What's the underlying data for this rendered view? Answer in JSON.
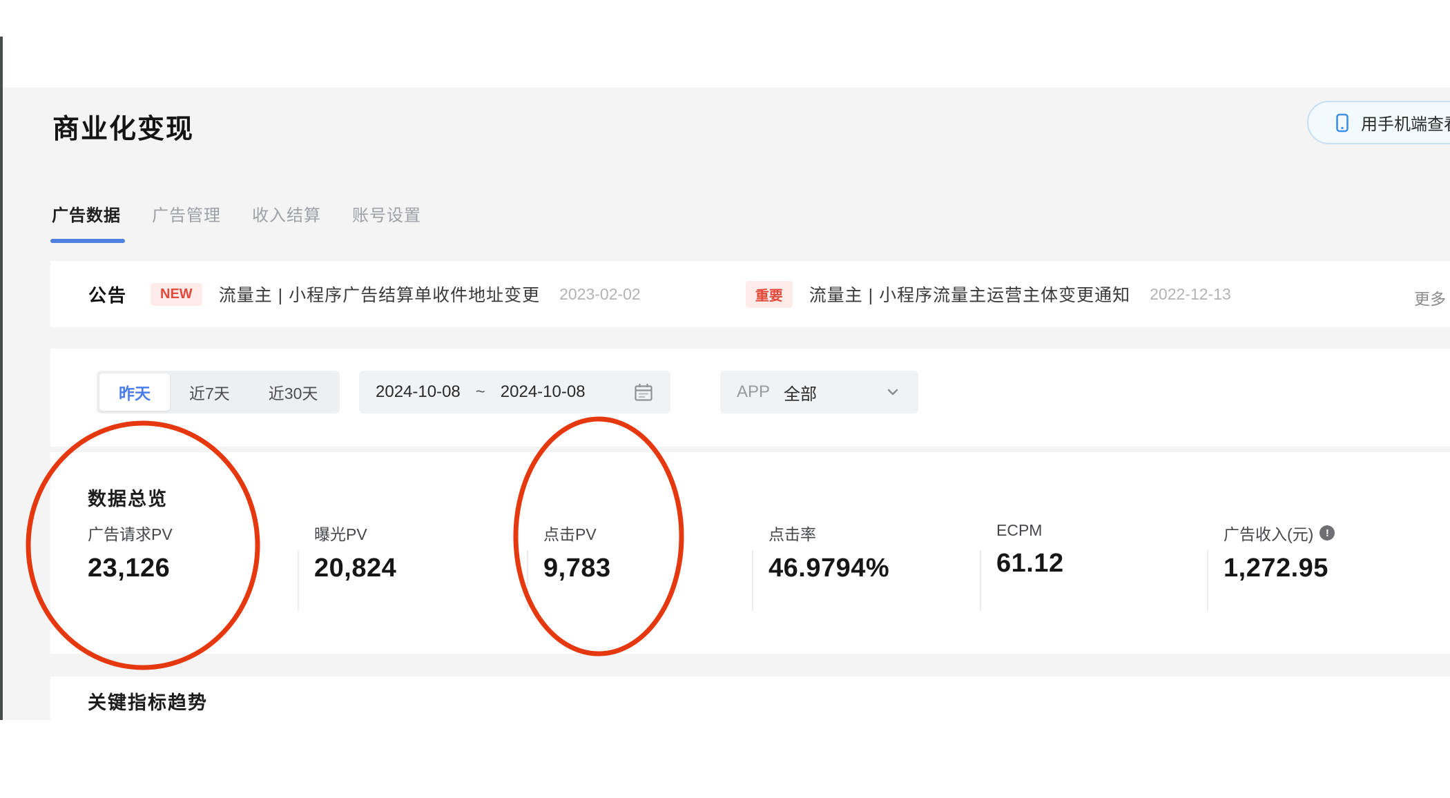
{
  "page": {
    "title": "商业化变现",
    "mobile_button_label": "用手机端查看数据",
    "more_label": "更多"
  },
  "tabs": [
    {
      "label": "广告数据",
      "active": true
    },
    {
      "label": "广告管理",
      "active": false
    },
    {
      "label": "收入结算",
      "active": false
    },
    {
      "label": "账号设置",
      "active": false
    }
  ],
  "announcement": {
    "heading": "公告",
    "items": [
      {
        "badge": "NEW",
        "text": "流量主 | 小程序广告结算单收件地址变更",
        "date": "2023-02-02"
      },
      {
        "badge": "重要",
        "text": "流量主 | 小程序流量主运营主体变更通知",
        "date": "2022-12-13"
      }
    ]
  },
  "filters": {
    "quick_ranges": [
      {
        "label": "昨天",
        "active": true
      },
      {
        "label": "近7天",
        "active": false
      },
      {
        "label": "近30天",
        "active": false
      }
    ],
    "date_start": "2024-10-08",
    "date_separator": "~",
    "date_end": "2024-10-08",
    "app_label": "APP",
    "app_value": "全部"
  },
  "overview": {
    "heading": "数据总览",
    "metrics": [
      {
        "label": "广告请求PV",
        "value": "23,126",
        "circled": true
      },
      {
        "label": "曝光PV",
        "value": "20,824",
        "circled": false
      },
      {
        "label": "点击PV",
        "value": "9,783",
        "circled": true
      },
      {
        "label": "点击率",
        "value": "46.9794%",
        "circled": false
      },
      {
        "label": "ECPM",
        "value": "61.12",
        "circled": false
      },
      {
        "label": "广告收入(元)",
        "value": "1,272.95",
        "circled": false,
        "info_glyph": "!"
      }
    ]
  },
  "trends": {
    "heading": "关键指标趋势"
  },
  "colors": {
    "accent_blue": "#4e80e0",
    "annotation_red": "#e6380f",
    "badge_bg": "#fdecea",
    "badge_text": "#e2493a",
    "page_bg": "#f4f4f5"
  }
}
